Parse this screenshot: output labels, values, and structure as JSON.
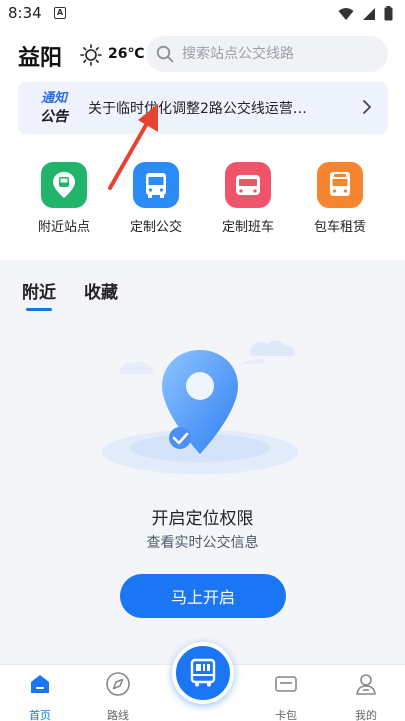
{
  "status_bar": {
    "time": "8:34",
    "notification_icon": "A"
  },
  "header": {
    "city": "益阳",
    "temperature": "26℃",
    "weather_icon": "sun-icon",
    "search_placeholder": "搜索站点公交线路"
  },
  "notice": {
    "badge_top": "通知",
    "badge_bottom": "公告",
    "text": "关于临时优化调整2路公交线运营…"
  },
  "quick_actions": [
    {
      "label": "附近站点",
      "icon": "nearby-stop-icon",
      "color": "#22b46b"
    },
    {
      "label": "定制公交",
      "icon": "bus-icon",
      "color": "#2b8cf7"
    },
    {
      "label": "定制班车",
      "icon": "shuttle-icon",
      "color": "#f0546a"
    },
    {
      "label": "包车租赁",
      "icon": "rental-bus-icon",
      "color": "#f5862f"
    }
  ],
  "content": {
    "tabs": [
      "附近",
      "收藏"
    ],
    "active_tab": "附近",
    "location_title": "开启定位权限",
    "location_subtitle": "查看实时公交信息",
    "open_button": "马上开启"
  },
  "tabbar": {
    "items": [
      {
        "label": "首页",
        "icon": "home-icon",
        "active": true
      },
      {
        "label": "路线",
        "icon": "navigation-icon",
        "active": false
      },
      {
        "label": "卡包",
        "icon": "card-icon",
        "active": false
      },
      {
        "label": "我的",
        "icon": "profile-icon",
        "active": false
      }
    ],
    "center_icon": "bus-code-icon"
  },
  "colors": {
    "accent": "#1a76f5",
    "annotation_arrow": "#e8432f"
  }
}
